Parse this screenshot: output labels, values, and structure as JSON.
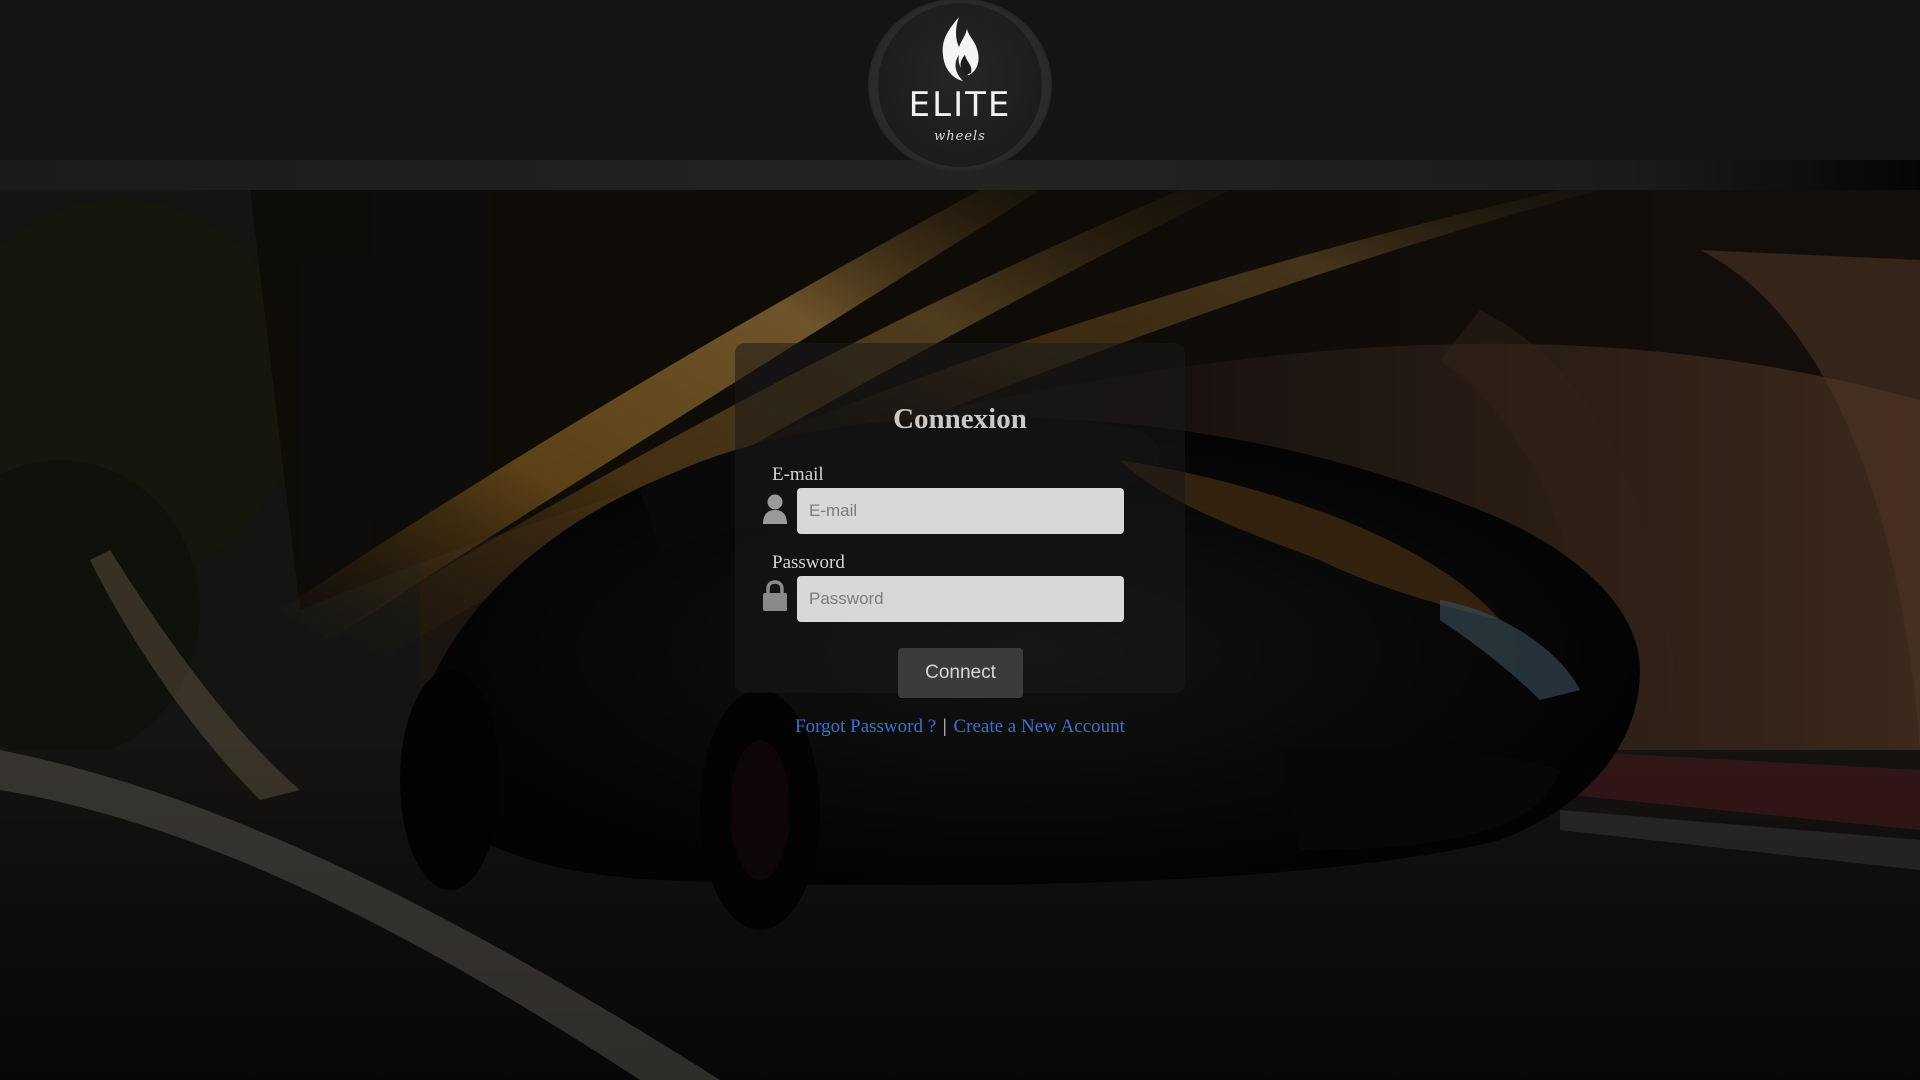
{
  "header": {
    "logo": {
      "wordmark": "ELITE",
      "subtitle": "wheels"
    }
  },
  "login": {
    "title": "Connexion",
    "email": {
      "label": "E-mail",
      "placeholder": "E-mail",
      "value": ""
    },
    "password": {
      "label": "Password",
      "placeholder": "Password",
      "value": ""
    },
    "connect_label": "Connect",
    "forgot_label": "Forgot Password ?",
    "separator": "|",
    "create_label": "Create a New Account"
  },
  "icons": {
    "email": "user-icon",
    "password": "lock-icon"
  },
  "colors": {
    "link": "#3a6fd8",
    "button": "#3b3b3b",
    "input": "#d8d8d8",
    "header": "#141414"
  }
}
